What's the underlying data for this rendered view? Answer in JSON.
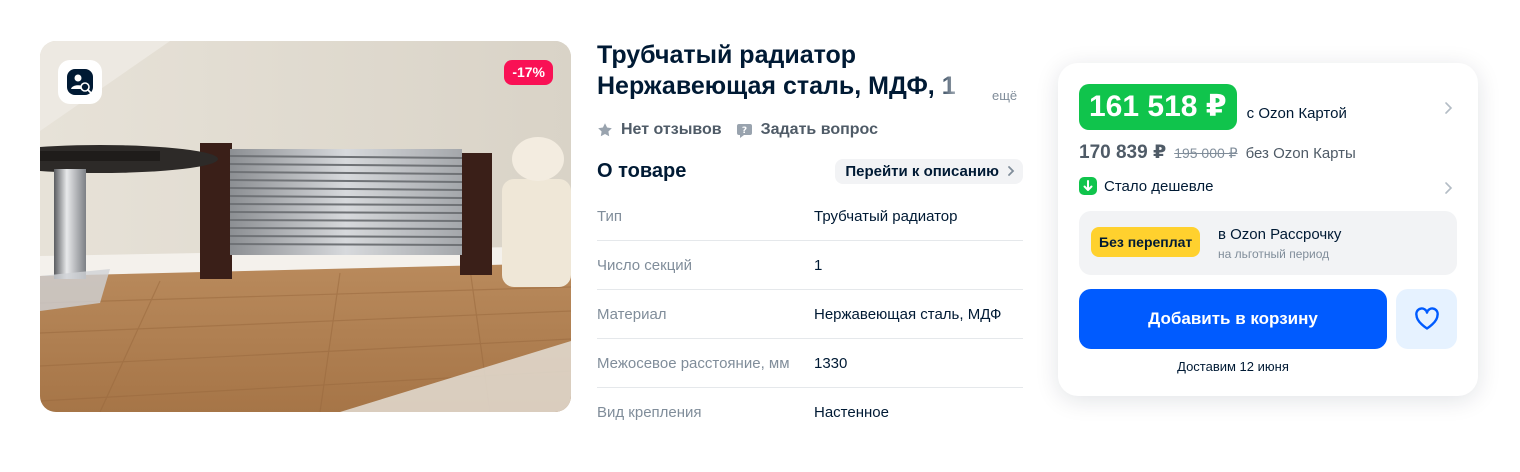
{
  "product": {
    "title": "Трубчатый радиатор Нержавеющая сталь, МДФ, 1",
    "more_label": "ещё",
    "discount": "-17%",
    "reviews_label": "Нет отзывов",
    "ask_label": "Задать вопрос"
  },
  "about": {
    "title": "О товаре",
    "desc_link": "Перейти к описанию",
    "specs": [
      {
        "key": "Тип",
        "value": "Трубчатый радиатор"
      },
      {
        "key": "Число секций",
        "value": "1"
      },
      {
        "key": "Материал",
        "value": "Нержавеющая сталь, МДФ"
      },
      {
        "key": "Межосевое расстояние, мм",
        "value": "1330"
      },
      {
        "key": "Вид крепления",
        "value": "Настенное"
      }
    ]
  },
  "buy": {
    "price_card": "161 518 ₽",
    "price_card_note": "с Ozon Картой",
    "price_regular": "170 839 ₽",
    "price_old": "195 000 ₽",
    "price_regular_note": "без Ozon Карты",
    "cheaper_label": "Стало дешевле",
    "installment_badge": "Без переплат",
    "installment_title": "в Ozon Рассрочку",
    "installment_sub": "на льготный период",
    "add_to_cart": "Добавить в корзину",
    "delivery": "Доставим 12 июня"
  },
  "colors": {
    "accent": "#005bff",
    "price_green": "#10c44c",
    "discount_pink": "#f91155",
    "installment_yellow": "#ffd12e"
  },
  "icons": {
    "photo_search": "image-search-icon",
    "star": "star-icon",
    "question": "question-chat-icon",
    "chevron": "chevron-right-icon",
    "cheaper": "arrow-down-icon",
    "favorite": "heart-icon"
  }
}
